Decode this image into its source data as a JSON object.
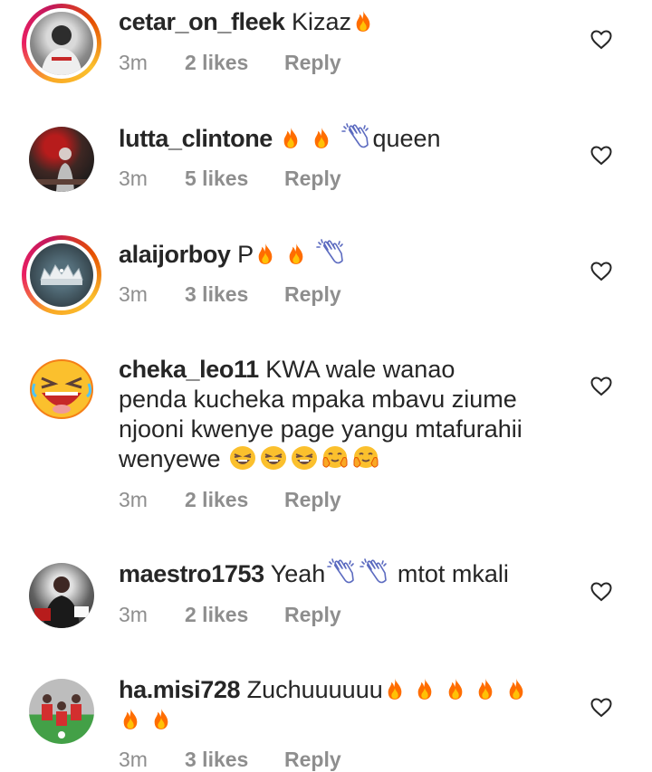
{
  "comments": [
    {
      "username": "cetar_on_fleek",
      "text": "Kizaz",
      "emoji_after": [
        "fire"
      ],
      "time": "3m",
      "likes": "2 likes",
      "reply": "Reply",
      "story_ring": true
    },
    {
      "username": "lutta_clintone",
      "text": "",
      "emoji_before": [
        "fire",
        "fire",
        "clap"
      ],
      "text_after": "queen",
      "time": "3m",
      "likes": "5 likes",
      "reply": "Reply",
      "story_ring": false
    },
    {
      "username": "alaijorboy",
      "text": "P",
      "emoji_after": [
        "fire",
        "fire",
        "clap"
      ],
      "time": "3m",
      "likes": "3 likes",
      "reply": "Reply",
      "story_ring": true
    },
    {
      "username": "cheka_leo11",
      "text_lines": [
        "KWA wale wanao",
        "penda kucheka mpaka mbavu ziume",
        "njooni kwenye page yangu mtafurahii",
        "wenyewe"
      ],
      "emoji_after": [
        "laugh",
        "laugh",
        "laugh",
        "hug",
        "hug"
      ],
      "time": "3m",
      "likes": "2 likes",
      "reply": "Reply",
      "story_ring": false
    },
    {
      "username": "maestro1753",
      "text": "Yeah",
      "emoji_mid": [
        "clap",
        "clap"
      ],
      "text_after": "mtot mkali",
      "time": "3m",
      "likes": "2 likes",
      "reply": "Reply",
      "story_ring": false
    },
    {
      "username": "ha.misi728",
      "text": "Zuchuuuuuu",
      "emoji_after": [
        "fire",
        "fire",
        "fire",
        "fire",
        "fire",
        "fire",
        "fire"
      ],
      "time": "3m",
      "likes": "3 likes",
      "reply": "Reply",
      "story_ring": false
    }
  ],
  "icons": {
    "like": "heart-outline-icon",
    "fire": "fire-emoji-icon",
    "clap": "clapping-hands-emoji-icon",
    "laugh": "laughing-face-emoji-icon",
    "hug": "hugging-face-emoji-icon"
  },
  "colors": {
    "text": "#262626",
    "meta": "#8e8e8e",
    "fire": "#ff6d00"
  }
}
